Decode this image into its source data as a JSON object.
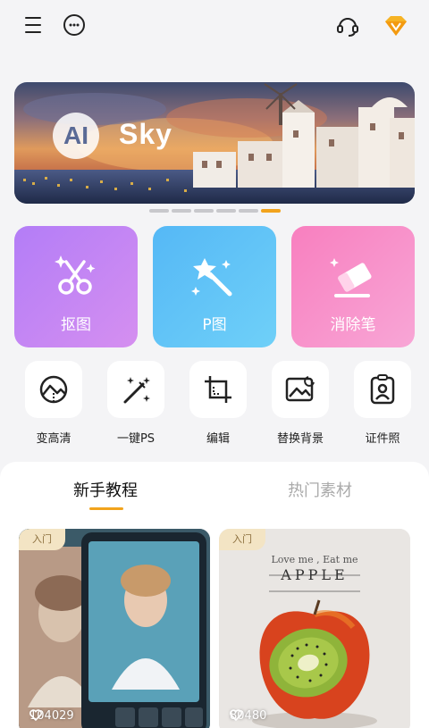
{
  "banner": {
    "ai_badge": "AI",
    "title": "Sky",
    "slides": 6,
    "active_slide": 6
  },
  "big_tools": [
    {
      "label": "抠图",
      "icon": "cutout-scissors-icon",
      "color": "#c085f4"
    },
    {
      "label": "P图",
      "icon": "magic-wand-icon",
      "color": "#5ec3f7"
    },
    {
      "label": "消除笔",
      "icon": "eraser-icon",
      "color": "#f992ca"
    }
  ],
  "small_tools": [
    {
      "label": "变高清",
      "icon": "enhance-icon"
    },
    {
      "label": "一键PS",
      "icon": "magic-wand-icon"
    },
    {
      "label": "编辑",
      "icon": "crop-icon"
    },
    {
      "label": "替换背景",
      "icon": "replace-background-icon"
    },
    {
      "label": "证件照",
      "icon": "id-photo-icon"
    }
  ],
  "tabs": [
    {
      "label": "新手教程",
      "active": true
    },
    {
      "label": "热门素材",
      "active": false
    }
  ],
  "cards": [
    {
      "badge": "入门",
      "likes": "104029"
    },
    {
      "badge": "入门",
      "likes": "80480",
      "caption_line1": "Love me , Eat me",
      "caption_line2": "APPLE"
    }
  ],
  "colors": {
    "accent": "#f2a31c"
  }
}
